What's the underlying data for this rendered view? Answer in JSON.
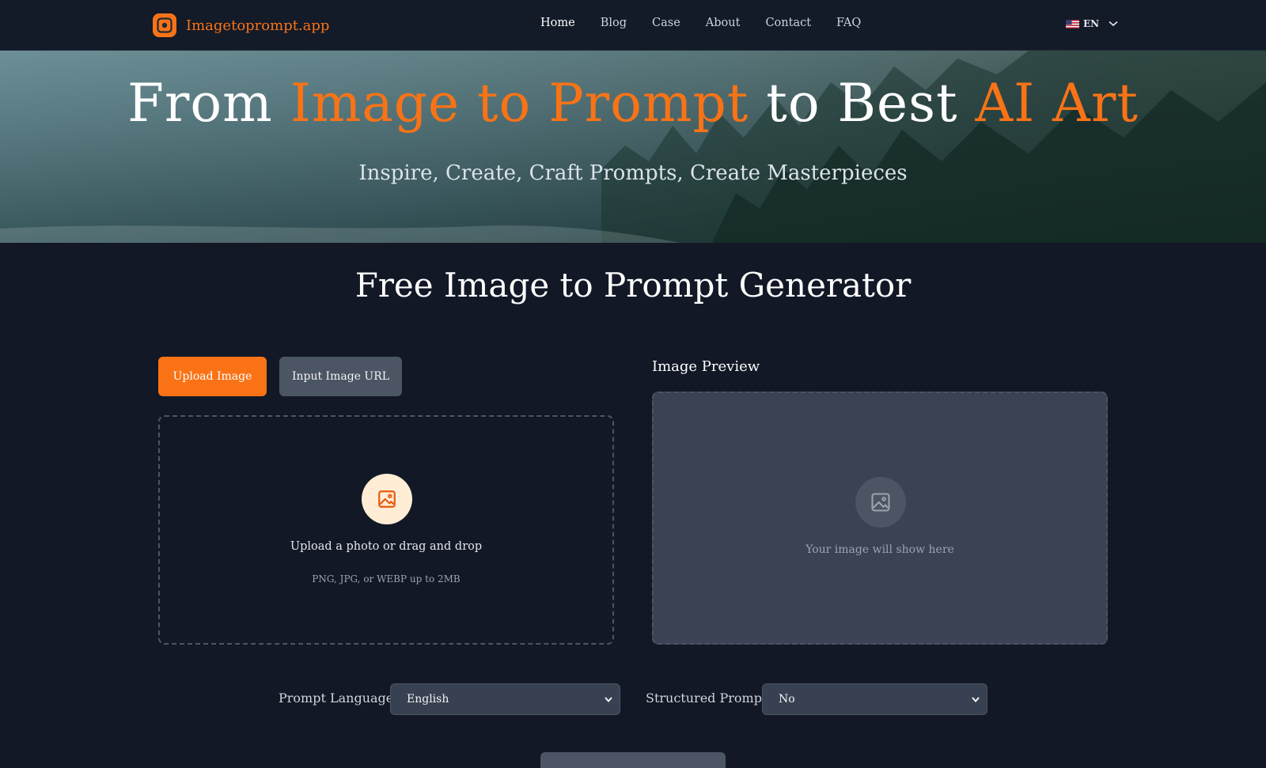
{
  "header": {
    "logo_text": "Imagetoprompt.app",
    "nav": [
      {
        "label": "Home",
        "active": true
      },
      {
        "label": "Blog"
      },
      {
        "label": "Case"
      },
      {
        "label": "About"
      },
      {
        "label": "Contact"
      },
      {
        "label": "FAQ"
      }
    ],
    "language": "EN",
    "language_icon": "us-flag-icon"
  },
  "hero": {
    "title_part1": "From ",
    "title_accent1": "Image to Prompt",
    "title_part2": " to Best ",
    "title_accent2": "AI Art",
    "subtitle": "Inspire, Create, Craft Prompts, Create Masterpieces"
  },
  "main": {
    "title": "Free Image to Prompt Generator",
    "tabs": {
      "upload_label": "Upload Image",
      "url_label": "Input Image URL"
    },
    "dropzone": {
      "icon": "image-icon",
      "text": "Upload a photo or drag and drop",
      "hint": "PNG, JPG, or WEBP up to 2MB"
    },
    "preview": {
      "label": "Image Preview",
      "icon": "image-icon",
      "placeholder": "Your image will show here"
    },
    "options": {
      "language_label": "Prompt Language",
      "language_value": "English",
      "structured_label": "Structured Prompt",
      "structured_value": "No"
    }
  },
  "colors": {
    "accent": "#f97316",
    "background": "#121826",
    "panel": "#3a4253"
  }
}
